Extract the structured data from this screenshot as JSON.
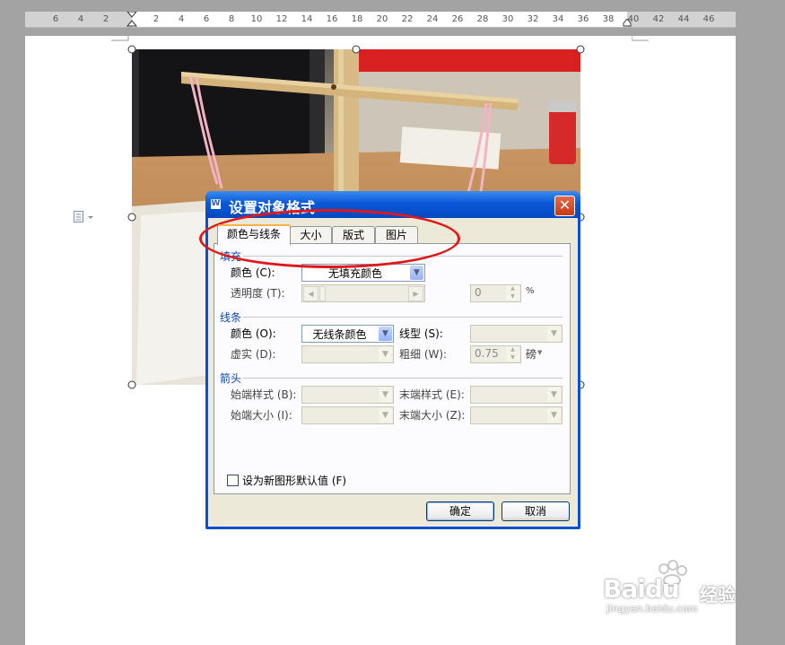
{
  "ruler": {
    "labels": [
      "6",
      "4",
      "2",
      "2",
      "4",
      "6",
      "8",
      "10",
      "12",
      "14",
      "16",
      "18",
      "20",
      "22",
      "24",
      "26",
      "28",
      "30",
      "32",
      "34",
      "36",
      "38",
      "40",
      "42",
      "44",
      "46"
    ]
  },
  "dialog": {
    "title": "设置对象格式",
    "app_icon": "W",
    "close_icon": "close-icon",
    "tabs": [
      {
        "label": "颜色与线条",
        "active": true
      },
      {
        "label": "大小",
        "active": false
      },
      {
        "label": "版式",
        "active": false
      },
      {
        "label": "图片",
        "active": false
      }
    ],
    "fill": {
      "section": "填充",
      "color_label": "颜色 (C):",
      "color_value": "无填充颜色",
      "transparency_label": "透明度 (T):",
      "transparency_value": "0",
      "transparency_unit": "%"
    },
    "line": {
      "section": "线条",
      "color_label": "颜色 (O):",
      "color_value": "无线条颜色",
      "type_label": "线型 (S):",
      "dash_label": "虚实 (D):",
      "weight_label": "粗细 (W):",
      "weight_value": "0.75",
      "weight_unit": "磅"
    },
    "arrows": {
      "section": "箭头",
      "begin_style_label": "始端样式 (B):",
      "end_style_label": "末端样式 (E):",
      "begin_size_label": "始端大小 (I):",
      "end_size_label": "末端大小 (Z):"
    },
    "default_checkbox": {
      "label": "设为新图形默认值 (F)",
      "checked": false
    },
    "ok_label": "确定",
    "cancel_label": "取消"
  },
  "watermark": {
    "brand": "Baidu",
    "brand_cn": "经验",
    "url": "jingyan.baidu.com"
  },
  "colors": {
    "title_bar": "#0a58d8",
    "dialog_bg": "#ece9d8",
    "highlight_circle": "#e01818",
    "section_text": "#0a46b4"
  }
}
